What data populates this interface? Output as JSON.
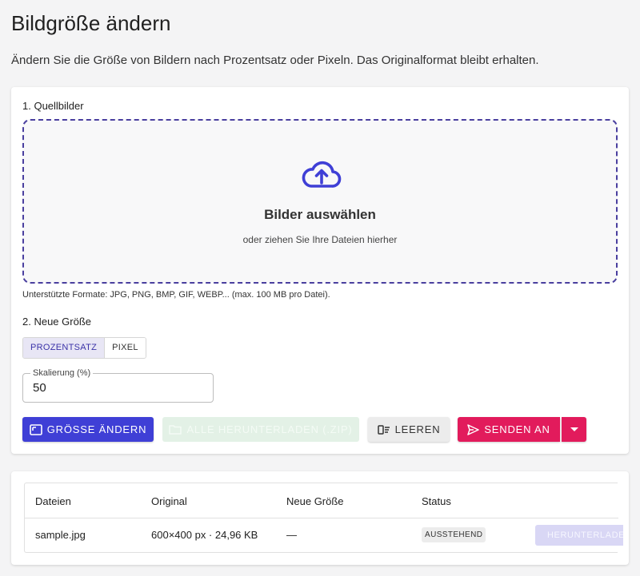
{
  "header": {
    "title": "Bildgröße ändern",
    "subtitle": "Ändern Sie die Größe von Bildern nach Prozentsatz oder Pixeln. Das Originalformat bleibt erhalten."
  },
  "source": {
    "section_label": "1. Quellbilder",
    "dropzone_title": "Bilder auswählen",
    "dropzone_subtitle": "oder ziehen Sie Ihre Dateien hierher",
    "dropzone_icon": "cloud-upload-icon",
    "formats_note": "Unterstützte Formate: JPG, PNG, BMP, GIF, WEBP... (max. 100 MB pro Datei)."
  },
  "resize": {
    "section_label": "2. Neue Größe",
    "mode_options": [
      "PROZENTSATZ",
      "PIXEL"
    ],
    "selected_mode": "PROZENTSATZ",
    "scale_label": "Skalierung (%)",
    "scale_value": "50"
  },
  "actions": {
    "resize_label": "GRÖSSE ÄNDERN",
    "download_all_label": "ALLE HERUNTERLADEN (.ZIP)",
    "clear_label": "LEEREN",
    "send_label": "SENDEN AN"
  },
  "table": {
    "headers": [
      "Dateien",
      "Original",
      "Neue Größe",
      "Status"
    ],
    "rows": [
      {
        "file": "sample.jpg",
        "original": "600×400 px · 24,96 KB",
        "new_size": "—",
        "status": "AUSSTEHEND",
        "download_label": "HERUNTERLADEN"
      }
    ]
  },
  "colors": {
    "primary": "#3f3fd6",
    "accent": "#e21b5c",
    "dropzone_border": "#4a3f9f",
    "disabled_green": "#e3f1e6"
  }
}
